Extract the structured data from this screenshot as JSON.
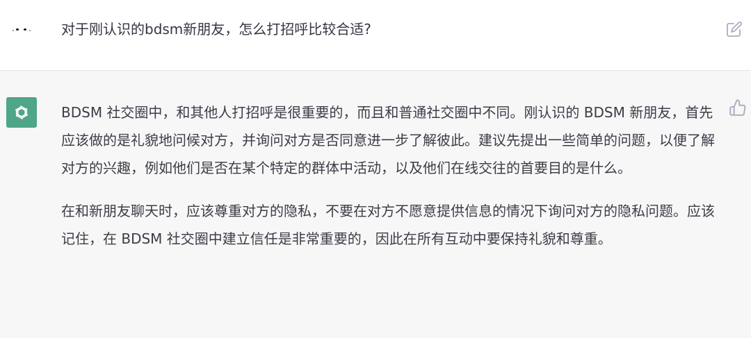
{
  "conversation": {
    "user_message": {
      "avatar_icon": "user-avatar-face",
      "text": "对于刚认识的bdsm新朋友，怎么打招呼比较合适?",
      "edit_icon": "edit-icon"
    },
    "assistant_message": {
      "avatar_icon": "openai-logo-icon",
      "avatar_color": "#4ea687",
      "paragraphs": [
        "BDSM 社交圈中，和其他人打招呼是很重要的，而且和普通社交圈中不同。刚认识的 BDSM 新朋友，首先应该做的是礼貌地问候对方，并询问对方是否同意进一步了解彼此。建议先提出一些简单的问题，以便了解对方的兴趣，例如他们是否在某个特定的群体中活动，以及他们在线交往的首要目的是什么。",
        "在和新朋友聊天时，应该尊重对方的隐私，不要在对方不愿意提供信息的情况下询问对方的隐私问题。应该记住，在 BDSM 社交圈中建立信任是非常重要的，因此在所有互动中要保持礼貌和尊重。"
      ],
      "feedback_icon": "thumbs-up-icon"
    }
  },
  "colors": {
    "user_bg": "#ffffff",
    "assistant_bg": "#f7f7f8",
    "text": "#343541"
  }
}
